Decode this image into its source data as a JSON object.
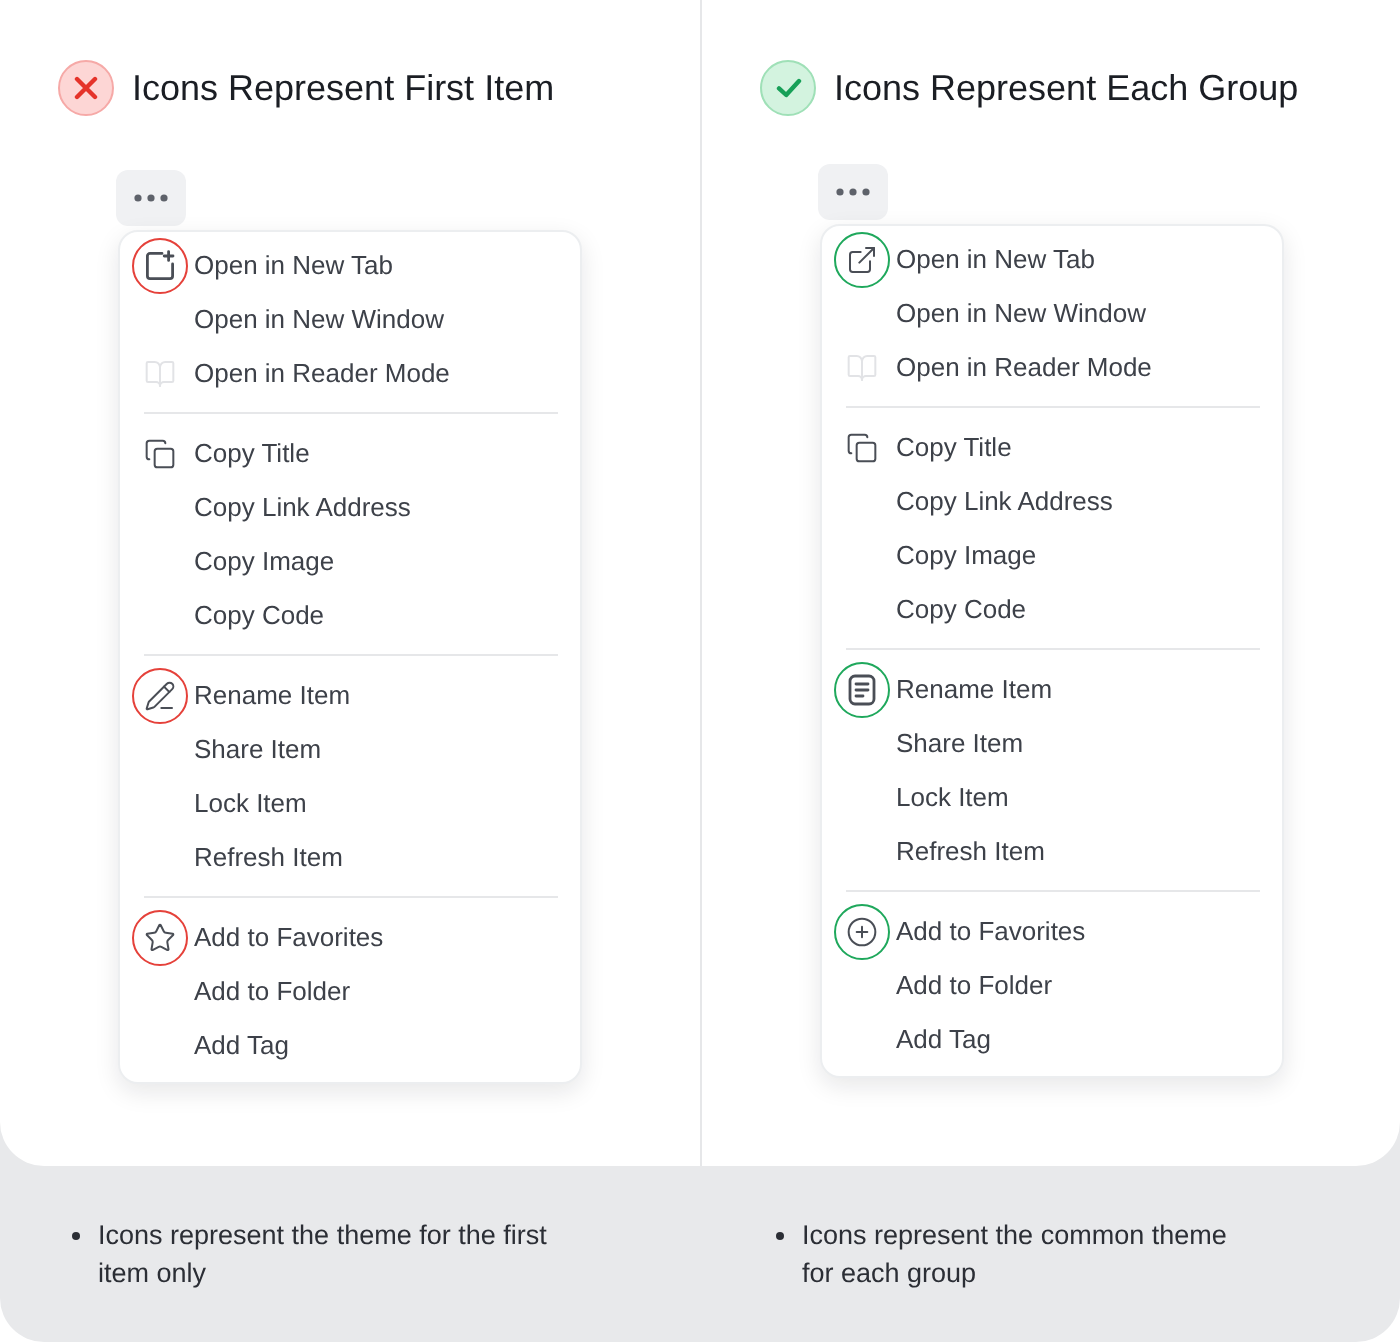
{
  "panels": [
    {
      "kind": "bad",
      "title": "Icons Represent First Item",
      "menu": {
        "groups": [
          {
            "items": [
              {
                "label": "Open in New Tab",
                "circled": true
              },
              {
                "label": "Open in New Window",
                "circled": false
              },
              {
                "label": "Open in Reader Mode",
                "circled": false
              }
            ]
          },
          {
            "items": [
              {
                "label": "Copy Title",
                "circled": false
              },
              {
                "label": "Copy Link Address",
                "circled": false
              },
              {
                "label": "Copy Image",
                "circled": false
              },
              {
                "label": "Copy Code",
                "circled": false
              }
            ]
          },
          {
            "items": [
              {
                "label": "Rename Item",
                "circled": true
              },
              {
                "label": "Share Item",
                "circled": false
              },
              {
                "label": "Lock Item",
                "circled": false
              },
              {
                "label": "Refresh Item",
                "circled": false
              }
            ]
          },
          {
            "items": [
              {
                "label": "Add to Favorites",
                "circled": true
              },
              {
                "label": "Add to Folder",
                "circled": false
              },
              {
                "label": "Add Tag",
                "circled": false
              }
            ]
          }
        ]
      }
    },
    {
      "kind": "good",
      "title": "Icons Represent Each Group",
      "menu": {
        "groups": [
          {
            "items": [
              {
                "label": "Open in New Tab",
                "circled": true
              },
              {
                "label": "Open in New Window",
                "circled": false
              },
              {
                "label": "Open in Reader Mode",
                "circled": false
              }
            ]
          },
          {
            "items": [
              {
                "label": "Copy Title",
                "circled": false
              },
              {
                "label": "Copy Link Address",
                "circled": false
              },
              {
                "label": "Copy Image",
                "circled": false
              },
              {
                "label": "Copy Code",
                "circled": false
              }
            ]
          },
          {
            "items": [
              {
                "label": "Rename Item",
                "circled": true
              },
              {
                "label": "Share Item",
                "circled": false
              },
              {
                "label": "Lock Item",
                "circled": false
              },
              {
                "label": "Refresh Item",
                "circled": false
              }
            ]
          },
          {
            "items": [
              {
                "label": "Add to Favorites",
                "circled": true
              },
              {
                "label": "Add to Folder",
                "circled": false
              },
              {
                "label": "Add Tag",
                "circled": false
              }
            ]
          }
        ]
      }
    }
  ],
  "captions": [
    "Icons represent the theme for the first item only",
    "Icons represent the common theme for each group"
  ]
}
